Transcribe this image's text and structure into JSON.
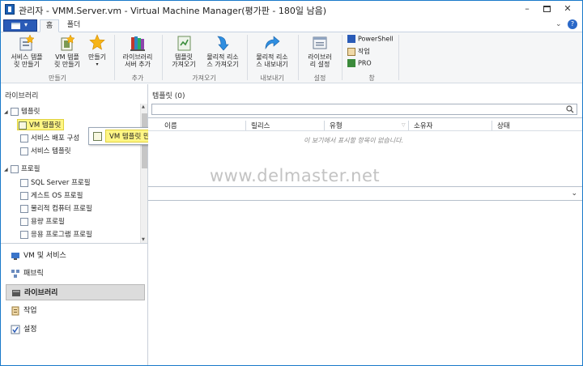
{
  "window": {
    "title": "관리자 - VMM.Server.vm - Virtual Machine Manager(평가판 - 180일 남음)",
    "minimize": "–",
    "maximize": "",
    "close": "✕"
  },
  "tabs": {
    "home": "홈",
    "folder": "폴더"
  },
  "ribbon": {
    "minimize_arrow": "⌄",
    "help": "?",
    "buttons": {
      "create_service_template": "서비스 템플\n릿 만들기",
      "create_vm_template": "VM 템플\n릿 만들기",
      "create": "만들기",
      "library_server_add": "라이브러리\n서버 추가",
      "import_template": "템플릿\n가져오기",
      "import_physical_resource": "물리적 리소\n스 가져오기",
      "export_physical_resource": "물리적 리소\n스 내보내기",
      "library_settings": "라이브러\n리 설정",
      "powershell": "PowerShell",
      "jobs": "작업",
      "pro": "PRO"
    },
    "groups": {
      "create": "만들기",
      "add": "추가",
      "import": "가져오기",
      "export": "내보내기",
      "settings": "설정",
      "window": "창"
    }
  },
  "left": {
    "title": "라이브러리",
    "tree": {
      "templates": "템플릿",
      "vm_templates": "VM 템플릿",
      "service_deploy": "서비스 배포 구성",
      "service_templates": "서비스 템플릿",
      "profiles": "프로필",
      "sql_server_profile": "SQL Server 프로필",
      "guest_os_profile": "게스트 OS 프로필",
      "physical_computer_profile": "물리적 컴퓨터 프로필",
      "capacity_profile": "용량 프로필",
      "application_profile": "응용 프로그램 프로필"
    },
    "nav": {
      "vms_services": "VM 및 서비스",
      "fabric": "패브릭",
      "library": "라이브러리",
      "jobs": "작업",
      "settings": "설정"
    }
  },
  "popup": {
    "label": "VM 템플릿 만들기"
  },
  "right": {
    "title": "템플릿 (0)",
    "search_placeholder": "",
    "columns": {
      "name": "이름",
      "release": "릴리스",
      "type": "유형",
      "owner": "소유자",
      "status": "상태"
    },
    "sort_indicator": "▽",
    "empty_message": "이 보기에서 표시할 항목이 없습니다.",
    "detail_chevron": "⌄"
  },
  "watermark": "www.delmaster.net",
  "colors": {
    "accent": "#2a5bb7",
    "selection": "#fff685",
    "border": "#1979ca"
  }
}
